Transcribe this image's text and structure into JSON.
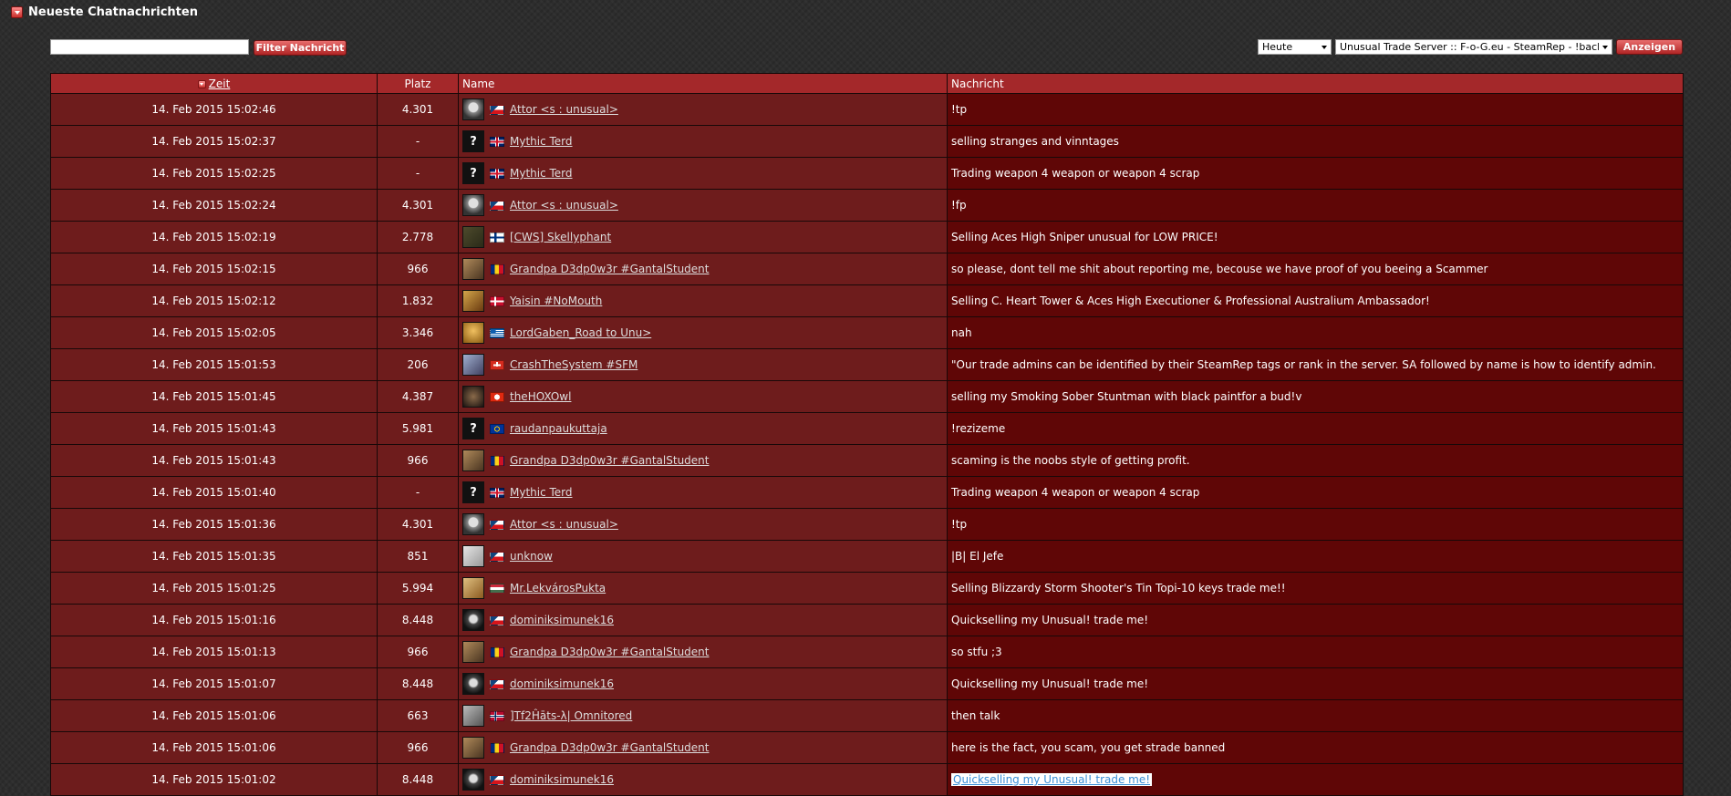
{
  "section": {
    "title": "Neueste Chatnachrichten"
  },
  "filter": {
    "input_value": "",
    "button_label": "Filter Nachricht"
  },
  "controls": {
    "day_select": "Heute",
    "server_select": "Unusual Trade Server :: F-o-G.eu - SteamRep - !backpack",
    "show_button": "Anzeigen"
  },
  "table": {
    "headers": {
      "time": "Zeit",
      "rank": "Platz",
      "name": "Name",
      "message": "Nachricht"
    },
    "rows": [
      {
        "time": "14. Feb 2015 15:02:46",
        "rank": "4.301",
        "avatar": "skull-avatar",
        "flag": "cz",
        "name": "Attor <s : unusual>",
        "message": "!tp"
      },
      {
        "time": "14. Feb 2015 15:02:37",
        "rank": "-",
        "avatar": "unknown-avatar",
        "flag": "gb",
        "name": "Mythic Terd",
        "message": "selling stranges and vinntages"
      },
      {
        "time": "14. Feb 2015 15:02:25",
        "rank": "-",
        "avatar": "unknown-avatar",
        "flag": "gb",
        "name": "Mythic Terd",
        "message": "Trading weapon 4 weapon or weapon 4 scrap"
      },
      {
        "time": "14. Feb 2015 15:02:24",
        "rank": "4.301",
        "avatar": "skull-avatar",
        "flag": "cz",
        "name": "Attor <s : unusual>",
        "message": "!fp"
      },
      {
        "time": "14. Feb 2015 15:02:19",
        "rank": "2.778",
        "avatar": "soldier-avatar",
        "flag": "fi",
        "name": "[CWS] Skellyphant",
        "message": "Selling Aces High Sniper unusual for LOW PRICE!"
      },
      {
        "time": "14. Feb 2015 15:02:15",
        "rank": "966",
        "avatar": "grandpa-avatar",
        "flag": "ro",
        "name": "Grandpa D3dp0w3r #GantalStudent",
        "message": "so please, dont tell me shit about reporting me, becouse we have proof of you beeing a Scammer"
      },
      {
        "time": "14. Feb 2015 15:02:12",
        "rank": "1.832",
        "avatar": "yaisin-avatar",
        "flag": "dk",
        "name": "Yaisin #NoMouth",
        "message": "Selling C. Heart Tower & Aces High Executioner & Professional Australium Ambassador!"
      },
      {
        "time": "14. Feb 2015 15:02:05",
        "rank": "3.346",
        "avatar": "gaben-avatar",
        "flag": "gr",
        "name": "LordGaben_Road to Unu>",
        "message": "nah"
      },
      {
        "time": "14. Feb 2015 15:01:53",
        "rank": "206",
        "avatar": "crash-avatar",
        "flag": "ch",
        "name": "CrashTheSystem #SFM",
        "message": "\"Our trade admins can be identified by their SteamRep tags or rank in the server. SA followed by name is how to identify admin."
      },
      {
        "time": "14. Feb 2015 15:01:45",
        "rank": "4.387",
        "avatar": "owl-avatar",
        "flag": "hk",
        "name": "theHOXOwl",
        "message": "selling my Smoking Sober Stuntman with black paintfor a bud!v"
      },
      {
        "time": "14. Feb 2015 15:01:43",
        "rank": "5.981",
        "avatar": "unknown-avatar",
        "flag": "eu",
        "name": "raudanpaukuttaja",
        "message": "!rezizeme"
      },
      {
        "time": "14. Feb 2015 15:01:43",
        "rank": "966",
        "avatar": "grandpa-avatar",
        "flag": "ro",
        "name": "Grandpa D3dp0w3r #GantalStudent",
        "message": "scaming is the noobs style of getting profit."
      },
      {
        "time": "14. Feb 2015 15:01:40",
        "rank": "-",
        "avatar": "unknown-avatar",
        "flag": "gb",
        "name": "Mythic Terd",
        "message": "Trading weapon 4 weapon or weapon 4 scrap"
      },
      {
        "time": "14. Feb 2015 15:01:36",
        "rank": "4.301",
        "avatar": "skull-avatar",
        "flag": "cz",
        "name": "Attor <s : unusual>",
        "message": "!tp"
      },
      {
        "time": "14. Feb 2015 15:01:35",
        "rank": "851",
        "avatar": "paper-avatar",
        "flag": "cz",
        "name": "unknow",
        "message": "|B| El Jefe"
      },
      {
        "time": "14. Feb 2015 15:01:25",
        "rank": "5.994",
        "avatar": "lekvaros-avatar",
        "flag": "hu",
        "name": "Mr.LekvárosPukta",
        "message": "Selling Blizzardy Storm Shooter's Tin Topi-10 keys trade me!!"
      },
      {
        "time": "14. Feb 2015 15:01:16",
        "rank": "8.448",
        "avatar": "dominik-avatar",
        "flag": "cz",
        "name": "dominiksimunek16",
        "message": "Quickselling my Unusual! trade me!"
      },
      {
        "time": "14. Feb 2015 15:01:13",
        "rank": "966",
        "avatar": "grandpa-avatar",
        "flag": "ro",
        "name": "Grandpa D3dp0w3r #GantalStudent",
        "message": "so stfu ;3"
      },
      {
        "time": "14. Feb 2015 15:01:07",
        "rank": "8.448",
        "avatar": "dominik-avatar",
        "flag": "cz",
        "name": "dominiksimunek16",
        "message": "Quickselling my Unusual! trade me!"
      },
      {
        "time": "14. Feb 2015 15:01:06",
        "rank": "663",
        "avatar": "omni-avatar",
        "flag": "no",
        "name": "]Tf2Ĥāts-λ| Omnitored",
        "message": "then talk"
      },
      {
        "time": "14. Feb 2015 15:01:06",
        "rank": "966",
        "avatar": "grandpa-avatar",
        "flag": "ro",
        "name": "Grandpa D3dp0w3r #GantalStudent",
        "message": "here is the fact, you scam, you get strade banned"
      },
      {
        "time": "14. Feb 2015 15:01:02",
        "rank": "8.448",
        "avatar": "dominik-avatar",
        "flag": "cz",
        "name": "dominiksimunek16",
        "message": "Quickselling my Unusual! trade me!",
        "selected": true
      }
    ]
  }
}
